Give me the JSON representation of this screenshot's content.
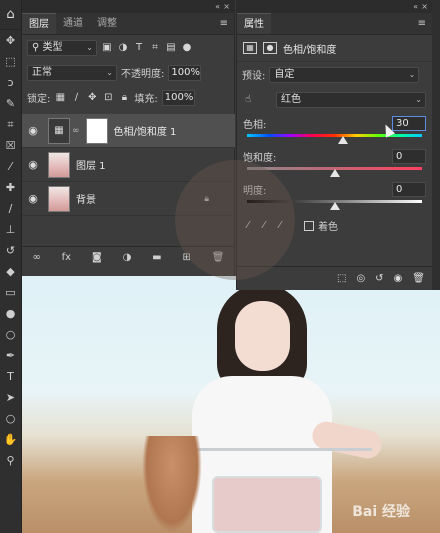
{
  "toolbar": {
    "home_icon": "home-icon",
    "tools": [
      "move-tool",
      "marquee-tool",
      "lasso-tool",
      "quick-select-tool",
      "crop-tool",
      "frame-tool",
      "eyedropper-tool",
      "spot-heal-tool",
      "brush-tool",
      "clone-stamp-tool",
      "history-brush-tool",
      "eraser-tool",
      "gradient-tool",
      "blur-tool",
      "dodge-tool",
      "pen-tool",
      "type-tool",
      "path-select-tool",
      "shape-tool",
      "hand-tool",
      "zoom-tool"
    ]
  },
  "layers_panel": {
    "tabs": [
      "图层",
      "通道",
      "调整"
    ],
    "active_tab": 0,
    "filter_kind": "类型",
    "blend_mode": "正常",
    "opacity_label": "不透明度:",
    "opacity_value": "100%",
    "lock_label": "锁定:",
    "fill_label": "填充:",
    "fill_value": "100%",
    "layers": [
      {
        "name": "色相/饱和度 1",
        "type": "adjustment",
        "selected": true
      },
      {
        "name": "图层 1",
        "type": "pixel",
        "selected": false
      },
      {
        "name": "背景",
        "type": "background",
        "selected": false,
        "locked": true
      }
    ]
  },
  "properties_panel": {
    "title": "属性",
    "adjustment_name": "色相/饱和度",
    "preset_label": "预设:",
    "preset_value": "自定",
    "channel_value": "红色",
    "hue_label": "色相:",
    "hue_value": "30",
    "saturation_label": "饱和度:",
    "saturation_value": "0",
    "lightness_label": "明度:",
    "lightness_value": "0",
    "colorize_label": "着色"
  },
  "sliders": {
    "hue_position": 0.55,
    "saturation_position": 0.5,
    "lightness_position": 0.5
  },
  "watermark": "Bai 经验"
}
